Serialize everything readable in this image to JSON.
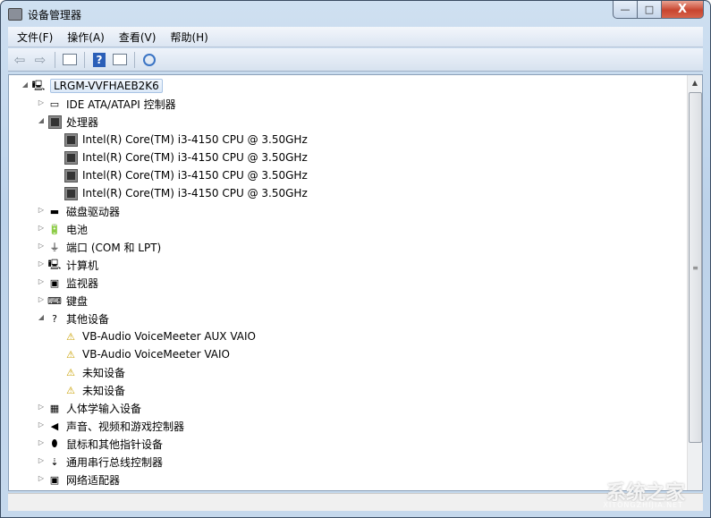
{
  "window": {
    "title": "设备管理器",
    "min": "—",
    "max": "□",
    "close": "X"
  },
  "menu": [
    "文件(F)",
    "操作(A)",
    "查看(V)",
    "帮助(H)"
  ],
  "toolbar": {
    "back": "⇦",
    "forward": "⇨",
    "help": "?"
  },
  "tree": [
    {
      "level": 0,
      "label": "LRGM-VVFHAEB2K6",
      "expanded": true,
      "icon": "computer-icon",
      "selected": true
    },
    {
      "level": 1,
      "label": "IDE ATA/ATAPI 控制器",
      "expanded": false,
      "icon": "ide-controller-icon"
    },
    {
      "level": 1,
      "label": "处理器",
      "expanded": true,
      "icon": "processor-icon"
    },
    {
      "level": 2,
      "label": "Intel(R) Core(TM) i3-4150 CPU @ 3.50GHz",
      "icon": "processor-icon"
    },
    {
      "level": 2,
      "label": "Intel(R) Core(TM) i3-4150 CPU @ 3.50GHz",
      "icon": "processor-icon"
    },
    {
      "level": 2,
      "label": "Intel(R) Core(TM) i3-4150 CPU @ 3.50GHz",
      "icon": "processor-icon"
    },
    {
      "level": 2,
      "label": "Intel(R) Core(TM) i3-4150 CPU @ 3.50GHz",
      "icon": "processor-icon"
    },
    {
      "level": 1,
      "label": "磁盘驱动器",
      "expanded": false,
      "icon": "disk-drive-icon"
    },
    {
      "level": 1,
      "label": "电池",
      "expanded": false,
      "icon": "battery-icon"
    },
    {
      "level": 1,
      "label": "端口 (COM 和 LPT)",
      "expanded": false,
      "icon": "port-icon"
    },
    {
      "level": 1,
      "label": "计算机",
      "expanded": false,
      "icon": "computer-icon"
    },
    {
      "level": 1,
      "label": "监视器",
      "expanded": false,
      "icon": "monitor-icon"
    },
    {
      "level": 1,
      "label": "键盘",
      "expanded": false,
      "icon": "keyboard-icon"
    },
    {
      "level": 1,
      "label": "其他设备",
      "expanded": true,
      "icon": "unknown-device-icon"
    },
    {
      "level": 2,
      "label": "VB-Audio VoiceMeeter AUX VAIO",
      "icon": "warning-device-icon"
    },
    {
      "level": 2,
      "label": "VB-Audio VoiceMeeter VAIO",
      "icon": "warning-device-icon"
    },
    {
      "level": 2,
      "label": "未知设备",
      "icon": "warning-device-icon"
    },
    {
      "level": 2,
      "label": "未知设备",
      "icon": "warning-device-icon"
    },
    {
      "level": 1,
      "label": "人体学输入设备",
      "expanded": false,
      "icon": "hid-icon"
    },
    {
      "level": 1,
      "label": "声音、视频和游戏控制器",
      "expanded": false,
      "icon": "speaker-icon"
    },
    {
      "level": 1,
      "label": "鼠标和其他指针设备",
      "expanded": false,
      "icon": "mouse-icon"
    },
    {
      "level": 1,
      "label": "通用串行总线控制器",
      "expanded": false,
      "icon": "usb-icon"
    },
    {
      "level": 1,
      "label": "网络适配器",
      "expanded": false,
      "icon": "network-adapter-icon"
    }
  ],
  "watermark": {
    "text": "系统之家",
    "sub": "XITONGZHIJIA.NET"
  }
}
